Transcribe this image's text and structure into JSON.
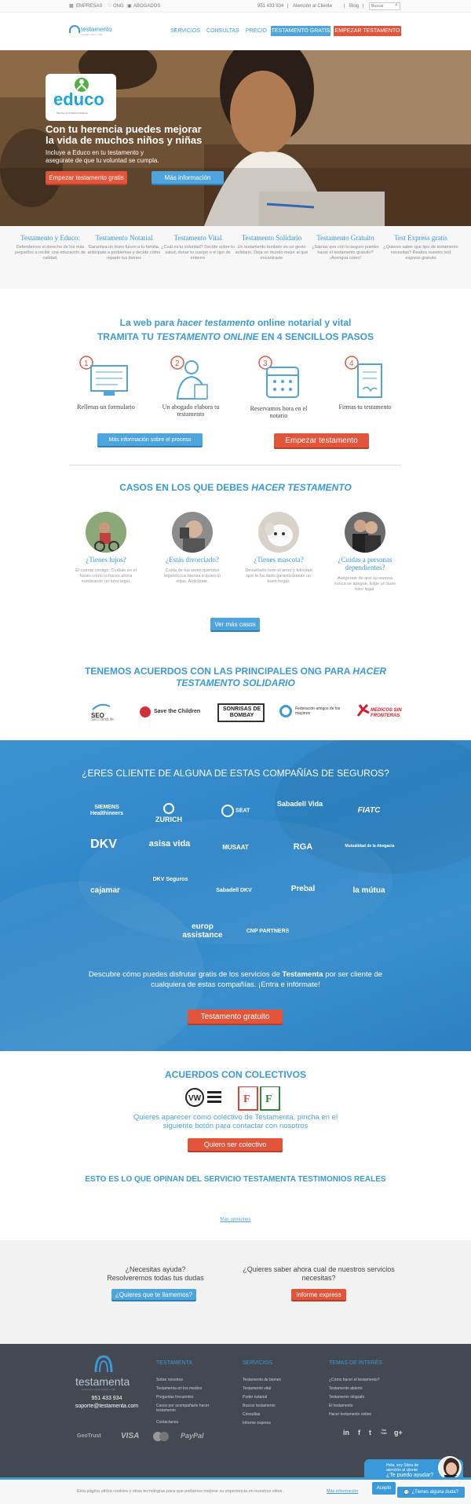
{
  "topbar": {
    "empresas": "EMPRESAS",
    "ong": "ONG",
    "abogados": "ABOGADOS",
    "phone": "951 433 934",
    "atencion": "Atención al Cliente",
    "blog": "Blog",
    "search_placeholder": "Buscar"
  },
  "header": {
    "logo": "testamento",
    "logo_sub": "notarial online y vital",
    "nav": [
      "SERVICIOS",
      "CONSULTAS",
      "PRECIO"
    ],
    "btn_gratis": "TESTAMENTO GRATIS",
    "btn_empezar": "EMPEZAR TESTAMENTO"
  },
  "hero": {
    "brand": "educo",
    "brand_sub": "Member of ChildFund Alliance",
    "title_line1": "Con tu herencia puedes mejorar",
    "title_line2": "la vida de muchos niños y niñas",
    "sub_line1": "Incluye a Educo en tu testamento y",
    "sub_line2": "asegúrate de que tu voluntad se cumpla.",
    "btn_start": "Empezar testamento gratis",
    "btn_info": "Más información"
  },
  "features": [
    {
      "title": "Testamento y Educo:",
      "text": "Defendemos el derecho de los más pequeños a recibir una educación de calidad."
    },
    {
      "title": "Testamento Notarial",
      "text": "Garantiza un buen futuro a tu familia, anticípate a problemas y decide cómo repartir tus bienes"
    },
    {
      "title": "Testamento Vital",
      "text": "¿Cuál es tu voluntad? Decide sobre tu salud, donar tu cuerpo o el tipo de entierro"
    },
    {
      "title": "Testamento Solidario",
      "text": "Un testamento también es un gesto solidario. Deja un mundo mejor al que encontraste"
    },
    {
      "title": "Testamento Gratuito",
      "text": "¿Sabías que con tu seguro puedes hacer el testamento gratuito? ¡Averigua cómo!"
    },
    {
      "title": "Test Express gratis",
      "text": "¿Quieres saber que tipo de testamento necesitas? Realiza nuestro test express gratuito"
    }
  ],
  "steps_section": {
    "tagline_pre": "La web para ",
    "tagline_em": "hacer testamento",
    "tagline_post": " online notarial y vital",
    "title_pre": "TRAMITA TU ",
    "title_em": "TESTAMENTO ONLINE",
    "title_post": " EN 4 SENCILLOS PASOS",
    "steps": [
      {
        "num": "1",
        "label": "Rellenas un formulario"
      },
      {
        "num": "2",
        "label": "Un abogado elabora tu testamento"
      },
      {
        "num": "3",
        "label": "Reservamos hora en el notario"
      },
      {
        "num": "4",
        "label": "Firmas tu testamento"
      }
    ],
    "btn_info": "Más información sobre el proceso",
    "btn_start": "Empezar testamento"
  },
  "cases": {
    "title_pre": "CASOS EN LOS QUE DEBES ",
    "title_em": "HACER TESTAMENTO",
    "items": [
      {
        "title": "¿Tienes hijos?",
        "text": "El cuenta contigo. Cuídale en el futuro como lo haces ahora nombrando un tutor legal."
      },
      {
        "title": "¿Estás divorciado?",
        "text": "Cuida de tus seres queridos legando tus bienes a quien tú elijas. Anticípate."
      },
      {
        "title": "¿Tienes mascota?",
        "text": "Devuélvele todo el amor y felicidad que te ha dado garantizándole un buen hogar."
      },
      {
        "title": "¿Cuidas a personas dependientes?",
        "text": "Asegúrate de que su sonrisa nunca se apague. Elige un buen tutor legal."
      }
    ],
    "btn_more": "Ver más casos"
  },
  "ong": {
    "title_pre": "TENEMOS ACUERDOS CON LAS PRINCIPALES ONG PARA ",
    "title_em": "HACER TESTAMENTO SOLIDARIO",
    "logos": [
      "SEO BirdLife",
      "Save the Children",
      "SONRISAS DE BOMBAY",
      "Federación amigos de los mayores",
      "MEDICOS SIN FRONTERAS"
    ]
  },
  "insurers": {
    "title": "¿ERES CLIENTE DE ALGUNA DE ESTAS COMPAÑÍAS DE SEGUROS?",
    "logos": [
      "SIEMENS Healthineers",
      "ZURICH",
      "SEAT",
      "Sabadell Vida",
      "FIATC",
      "DKV",
      "asisa vida",
      "MUSAAT",
      "RGA",
      "Mutualidad de la Abogacía",
      "cajamar",
      "DKV Seguros",
      "Sabadell DKV",
      "Prebal",
      "la mútua",
      "europ assistance",
      "CNP PARTNERS"
    ],
    "desc_pre": "Descubre cómo puedes disfrutar gratis de los servicios de ",
    "desc_bold": "Testamenta",
    "desc_post": " por ser cliente de cualquiera de estas compañías. ¡Entra e infórmate!",
    "btn": "Testamento gratuito"
  },
  "colectivos": {
    "title": "ACUERDOS CON COLECTIVOS",
    "desc": "Quieres aparecer como colectivo de Testamenta, pincha en el siguiente botón para contactar con nosotros",
    "btn": "Quiero ser colectivo"
  },
  "testimonials": {
    "title": "ESTO ES LO QUE OPINAN DEL SERVICIO TESTAMENTA TESTIMONIOS REALES",
    "link": "Más opiniones"
  },
  "help": {
    "left_line1": "¿Necesitas ayuda?",
    "left_line2": "Resolveremos todas tus dudas",
    "left_btn": "¿Quieres que te llamemos?",
    "right_line1": "¿Quieres saber ahora cual de nuestros servicios",
    "right_line2": "necesitas?",
    "right_btn": "Informe express"
  },
  "footer": {
    "logo": "testamenta",
    "logo_sub": "testamento online notarial y vital",
    "phone": "951 433 934",
    "email": "soporte@testamenta.com",
    "col1_title": "TESTAMENTA",
    "col1": [
      "Sobre nosotros",
      "Testamenta en los medios",
      "Preguntas frecuentes",
      "Casos por acompañarte hacer testamento",
      "Contáctanos"
    ],
    "col2_title": "SERVICIOS",
    "col2": [
      "Testamento de bienes",
      "Testamento vital",
      "Poder notarial",
      "Buscar testamento",
      "Consultas",
      "Informe express"
    ],
    "col3_title": "TEMAS DE INTERÉS",
    "col3": [
      "¿Cómo hacer el testamento?",
      "Testamento abierto",
      "Testamento ológrafo",
      "El testamento",
      "Hacer testamento online"
    ],
    "payments": [
      "GeoTrust",
      "VISA",
      "MasterCard",
      "PayPal"
    ],
    "social": [
      "in",
      "f",
      "t",
      "You Tube",
      "g+"
    ]
  },
  "chat": {
    "line1": "Hola, soy Silvia de",
    "line2": "atención al cliente",
    "line3": "¿Te puedo ayudar?",
    "tab": "¿Tienes alguna duda?"
  },
  "cookie": {
    "text": "Esta página utiliza cookies y otras tecnologías para que podamos mejorar su experiencia en nuestros sitios.",
    "link": "Más información",
    "btn": "Acepto"
  },
  "colors": {
    "accent_blue": "#3a9ad9",
    "accent_orange": "#e2553b",
    "footer_bg": "#444851"
  }
}
